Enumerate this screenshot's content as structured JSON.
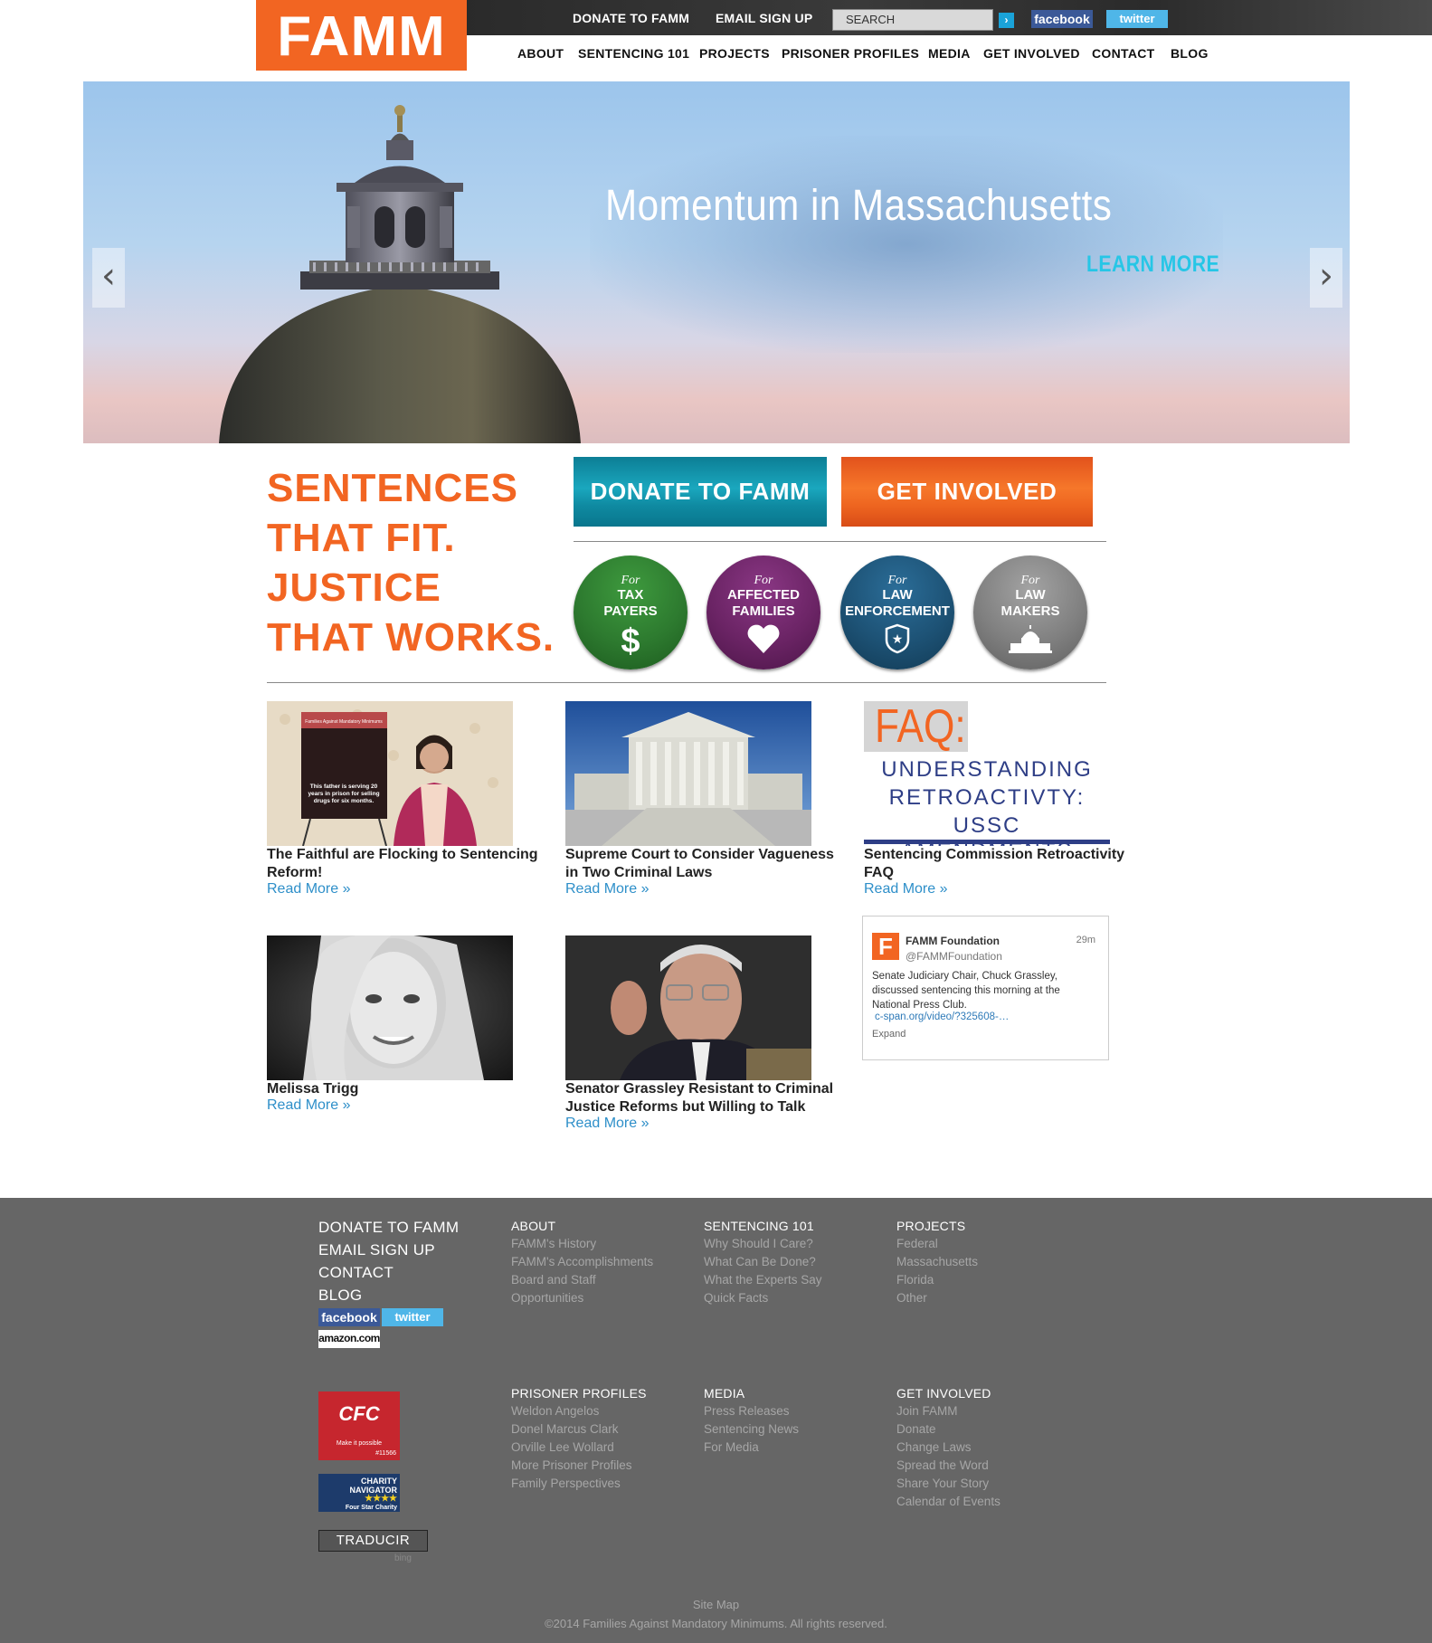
{
  "header": {
    "logo": "FAMM",
    "top_links": [
      "DONATE TO FAMM",
      "EMAIL SIGN UP"
    ],
    "search_placeholder": "SEARCH",
    "search_go": "›",
    "facebook": "facebook",
    "twitter": "twitter",
    "nav": [
      "ABOUT",
      "SENTENCING 101",
      "PROJECTS",
      "PRISONER PROFILES",
      "MEDIA",
      "GET INVOLVED",
      "CONTACT",
      "BLOG"
    ]
  },
  "hero": {
    "title": "Momentum in Massachusetts",
    "cta": "LEARN MORE",
    "prev": "‹",
    "next": "›"
  },
  "tagline": [
    "SENTENCES",
    "THAT FIT.",
    "JUSTICE",
    "THAT WORKS."
  ],
  "cta": {
    "donate": "DONATE TO FAMM",
    "involved": "GET INVOLVED"
  },
  "audiences": [
    {
      "for": "For",
      "line1": "TAX",
      "line2": "PAYERS",
      "icon": "dollar-icon",
      "color": "#2d7a2f"
    },
    {
      "for": "For",
      "line1": "AFFECTED",
      "line2": "FAMILIES",
      "icon": "heart-icon",
      "color": "#6b2465"
    },
    {
      "for": "For",
      "line1": "LAW",
      "line2": "ENFORCEMENT",
      "icon": "badge-icon",
      "color": "#1d5275"
    },
    {
      "for": "For",
      "line1": "LAW",
      "line2": "MAKERS",
      "icon": "capitol-icon",
      "color": "#7d7d7d"
    }
  ],
  "articles": [
    {
      "title": "The Faithful are Flocking to Sentencing Reform!",
      "read_more": "Read More »"
    },
    {
      "title": "Supreme Court to Consider Vagueness in Two Criminal Laws",
      "read_more": "Read More »"
    },
    {
      "title": "Sentencing Commission Retroactivity FAQ",
      "read_more": "Read More »"
    },
    {
      "title": "Melissa Trigg",
      "read_more": "Read More »"
    },
    {
      "title": "Senator Grassley Resistant to Criminal Justice Reforms but Willing to Talk",
      "read_more": "Read More »"
    }
  ],
  "faq_image": {
    "heading": "FAQ:",
    "line1": "UNDERSTANDING",
    "line2": "RETROACTIVTY:",
    "line3": "USSC AMENDMENTS"
  },
  "poster_text": "This father is serving 20 years in prison for selling drugs for six months.",
  "tweet": {
    "name": "FAMM Foundation",
    "handle": "@FAMMFoundation",
    "time": "29m",
    "text": "Senate Judiciary Chair, Chuck Grassley, discussed sentencing this morning at the National Press Club.",
    "link": "c-span.org/video/?325608-…",
    "expand": "Expand"
  },
  "footer": {
    "main_links": [
      "DONATE TO FAMM",
      "EMAIL SIGN UP",
      "CONTACT",
      "BLOG"
    ],
    "facebook": "facebook",
    "twitter": "twitter",
    "amazon": "amazon.com",
    "columns_top": [
      {
        "heading": "ABOUT",
        "links": [
          "FAMM's History",
          "FAMM's Accomplishments",
          "Board and Staff",
          "Opportunities"
        ]
      },
      {
        "heading": "SENTENCING 101",
        "links": [
          "Why Should I Care?",
          "What Can Be Done?",
          "What the Experts Say",
          "Quick Facts"
        ]
      },
      {
        "heading": "PROJECTS",
        "links": [
          "Federal",
          "Massachusetts",
          "Florida",
          "Other"
        ]
      }
    ],
    "columns_bottom": [
      {
        "heading": "PRISONER PROFILES",
        "links": [
          "Weldon Angelos",
          "Donel Marcus Clark",
          "Orville Lee Wollard",
          "More Prisoner Profiles",
          "Family Perspectives"
        ]
      },
      {
        "heading": "MEDIA",
        "links": [
          "Press Releases",
          "Sentencing News",
          "For Media"
        ]
      },
      {
        "heading": "GET INVOLVED",
        "links": [
          "Join FAMM",
          "Donate",
          "Change Laws",
          "Spread the Word",
          "Share Your Story",
          "Calendar of Events"
        ]
      }
    ],
    "cfc": {
      "logo": "CFC",
      "tagline": "Make it possible",
      "number": "#11566"
    },
    "charity": {
      "line1": "CHARITY",
      "line2": "NAVIGATOR",
      "stars": "★★★★",
      "line3": "Four Star Charity"
    },
    "translate": "TRADUCIR",
    "bing": "bing",
    "site_map": "Site Map",
    "copyright": "©2014 Families Against Mandatory Minimums. All rights reserved."
  }
}
